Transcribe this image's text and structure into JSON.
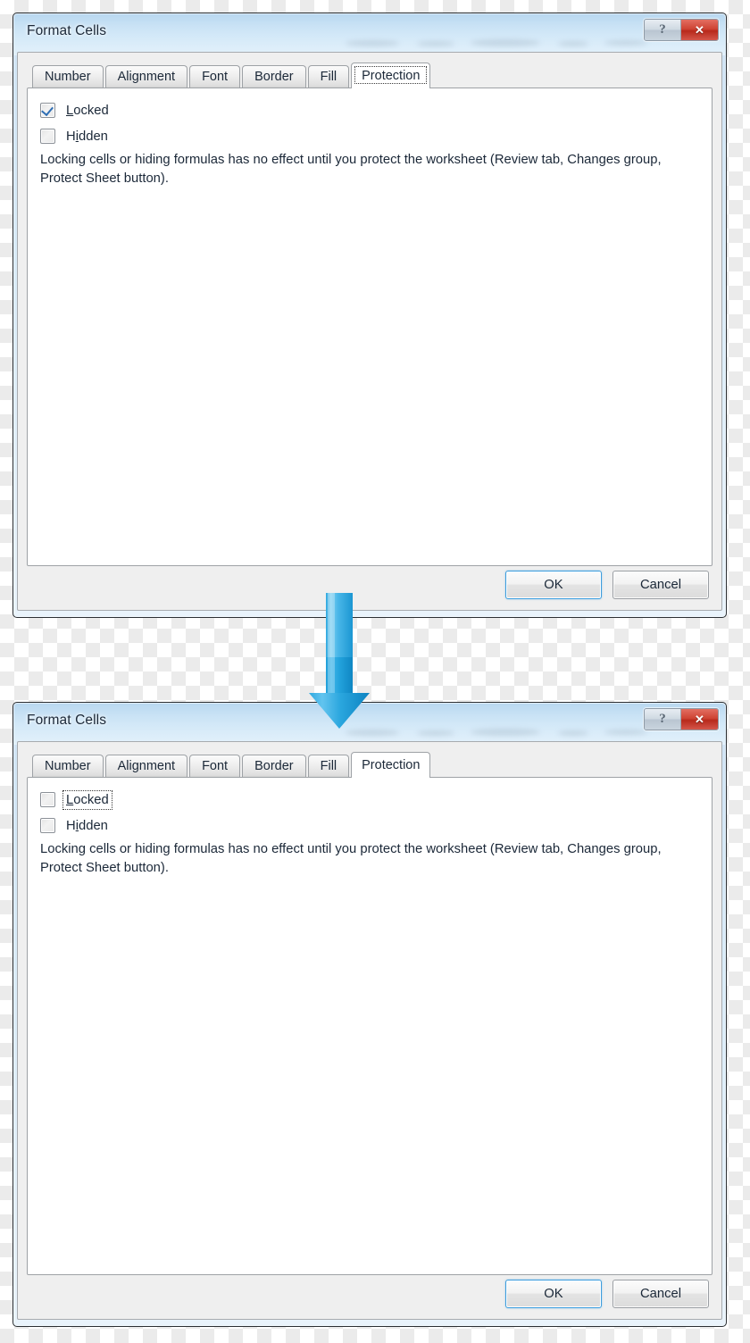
{
  "window_title": "Format Cells",
  "caption": {
    "help_label": "?",
    "help_icon": "question-mark-icon",
    "close_label": "✕",
    "close_icon": "close-x-icon"
  },
  "tabs": [
    {
      "label": "Number"
    },
    {
      "label": "Alignment"
    },
    {
      "label": "Font"
    },
    {
      "label": "Border"
    },
    {
      "label": "Fill"
    },
    {
      "label": "Protection"
    }
  ],
  "active_tab": "Protection",
  "checkboxes": {
    "locked": {
      "label_pre": "",
      "accel": "L",
      "label_post": "ocked"
    },
    "hidden": {
      "label_pre": "H",
      "accel": "i",
      "label_post": "dden"
    }
  },
  "hint_text": "Locking cells or hiding formulas has no effect until you protect the worksheet (Review tab, Changes group, Protect Sheet button).",
  "buttons": {
    "ok": "OK",
    "cancel": "Cancel"
  },
  "dialog_top": {
    "locked_checked": true,
    "hidden_checked": false,
    "focus": "tab-protection"
  },
  "dialog_bottom": {
    "locked_checked": false,
    "hidden_checked": false,
    "focus": "locked-checkbox"
  },
  "arrow": {
    "icon": "down-arrow-icon",
    "color_light": "#5cc4ef",
    "color_dark": "#1f9fdb",
    "direction": "down"
  },
  "colors": {
    "accent_blue": "#3c9ddd",
    "checkmark_blue": "#2f6fb5",
    "close_red": "#c5392a",
    "glass_blue": "#cfe3f4",
    "client_gray": "#efefef"
  }
}
